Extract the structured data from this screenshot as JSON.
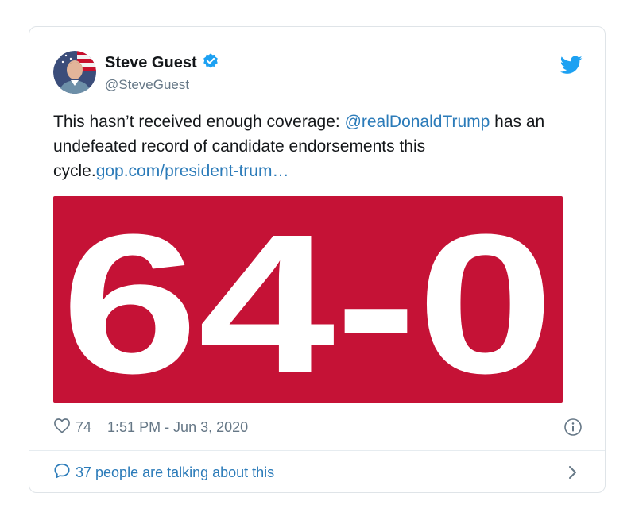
{
  "author": {
    "display_name": "Steve Guest",
    "handle": "@SteveGuest",
    "verified": true
  },
  "tweet": {
    "text_before": "This hasn’t received enough coverage: ",
    "mention": "@realDonaldTrump",
    "text_middle": " has an undefeated record of candidate endorsements this cycle.",
    "link": "gop.com/president-trum…"
  },
  "media": {
    "headline": "64-0",
    "background_color": "#c51236"
  },
  "footer": {
    "like_count": "74",
    "timestamp": "1:51 PM - Jun 3, 2020"
  },
  "conversation": {
    "label": "37 people are talking about this"
  },
  "icons": {
    "verified": "verified-badge-icon",
    "platform": "twitter-bird-icon",
    "like": "heart-icon",
    "info": "info-icon",
    "reply": "speech-bubble-icon",
    "more": "chevron-right-icon"
  },
  "colors": {
    "link": "#2b7bb9",
    "twitter_blue": "#1da1f2",
    "muted": "#657786"
  }
}
